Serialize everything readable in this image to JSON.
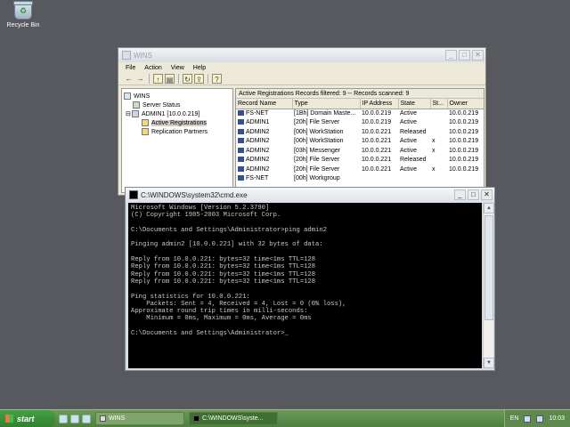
{
  "desktop": {
    "recycle_bin_label": "Recycle Bin"
  },
  "wins": {
    "title": "WINS",
    "menu": [
      "File",
      "Action",
      "View",
      "Help"
    ],
    "tree": [
      {
        "label": "WINS"
      },
      {
        "label": "Server Status"
      },
      {
        "label": "ADMIN1 [10.0.0.219]"
      },
      {
        "label": "Active Registrations"
      },
      {
        "label": "Replication Partners"
      }
    ],
    "pane_header": "Active Registrations    Records filtered: 9 -- Records scanned: 9",
    "columns": [
      "Record Name",
      "Type",
      "IP Address",
      "State",
      "St...",
      "Owner"
    ],
    "rows": [
      [
        "FS-NET",
        "[1Bh] Domain Maste...",
        "10.0.0.219",
        "Active",
        "",
        "10.0.0.219"
      ],
      [
        "ADMIN1",
        "[20h] File Server",
        "10.0.0.219",
        "Active",
        "",
        "10.0.0.219"
      ],
      [
        "ADMIN2",
        "[00h] WorkStation",
        "10.0.0.221",
        "Released",
        "",
        "10.0.0.219"
      ],
      [
        "ADMIN2",
        "[00h] WorkStation",
        "10.0.0.221",
        "Active",
        "x",
        "10.0.0.219"
      ],
      [
        "ADMIN2",
        "[03h] Messenger",
        "10.0.0.221",
        "Active",
        "x",
        "10.0.0.219"
      ],
      [
        "ADMIN2",
        "[20h] File Server",
        "10.0.0.221",
        "Released",
        "",
        "10.0.0.219"
      ],
      [
        "ADMIN2",
        "[20h] File Server",
        "10.0.0.221",
        "Active",
        "x",
        "10.0.0.219"
      ],
      [
        "FS-NET",
        "[00h] Workgroup",
        "",
        "",
        "",
        ""
      ]
    ]
  },
  "cmd": {
    "title": "C:\\WINDOWS\\system32\\cmd.exe",
    "lines": [
      "Microsoft Windows [Version 5.2.3790]",
      "(C) Copyright 1985-2003 Microsoft Corp.",
      "",
      "C:\\Documents and Settings\\Administrator>ping admin2",
      "",
      "Pinging admin2 [10.0.0.221] with 32 bytes of data:",
      "",
      "Reply from 10.0.0.221: bytes=32 time<1ms TTL=128",
      "Reply from 10.0.0.221: bytes=32 time<1ms TTL=128",
      "Reply from 10.0.0.221: bytes=32 time<1ms TTL=128",
      "Reply from 10.0.0.221: bytes=32 time<1ms TTL=128",
      "",
      "Ping statistics for 10.0.0.221:",
      "    Packets: Sent = 4, Received = 4, Lost = 0 (0% loss),",
      "Approximate round trip times in milli-seconds:",
      "    Minimum = 0ms, Maximum = 0ms, Average = 0ms",
      "",
      "C:\\Documents and Settings\\Administrator>_"
    ]
  },
  "taskbar": {
    "start_label": "start",
    "tasks": [
      "WINS",
      "C:\\WINDOWS\\syste..."
    ],
    "language": "EN",
    "clock": "10:03"
  },
  "colors": {
    "desktop": "#57595f",
    "taskbar": "#5a8a4a",
    "console_bg": "#000000"
  }
}
